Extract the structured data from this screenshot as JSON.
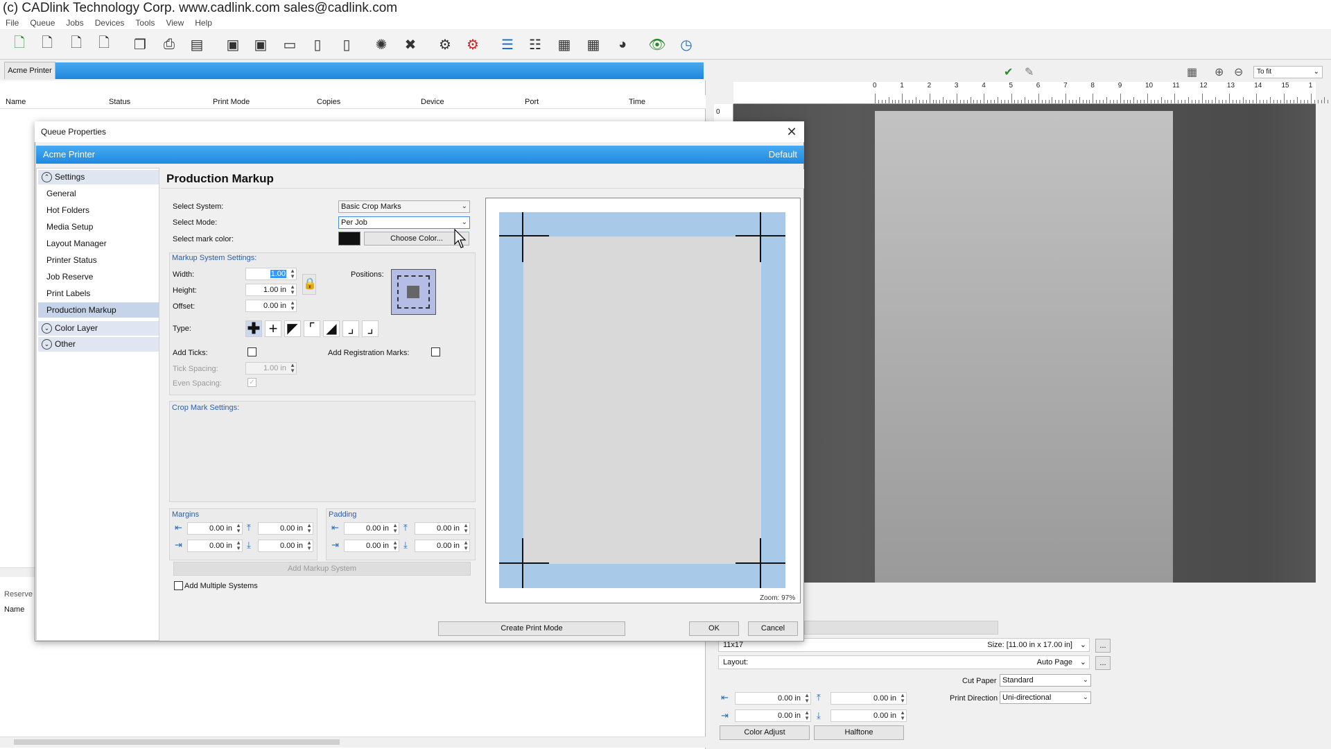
{
  "window": {
    "title": "(c) CADlink Technology Corp.  www.cadlink.com  sales@cadlink.com"
  },
  "menu": [
    "File",
    "Queue",
    "Jobs",
    "Devices",
    "Tools",
    "View",
    "Help"
  ],
  "queue": {
    "tab_label": "Acme Printer",
    "columns": [
      "Name",
      "Status",
      "Print Mode",
      "Copies",
      "Device",
      "Port",
      "Time"
    ],
    "reserve_tab": "Reserve",
    "reserve_column": "Name"
  },
  "preview": {
    "zoom_value": "To fit",
    "ruler_labels": [
      "0",
      "1",
      "2",
      "3",
      "4",
      "5",
      "6",
      "7",
      "8",
      "9",
      "10",
      "11",
      "12",
      "13",
      "14",
      "15",
      "1"
    ],
    "vruler_label": "0"
  },
  "dialog": {
    "title": "Queue Properties",
    "header_left": "Acme Printer",
    "header_right": "Default",
    "nav": {
      "settings": "Settings",
      "items": [
        "General",
        "Hot Folders",
        "Media Setup",
        "Layout Manager",
        "Printer Status",
        "Job Reserve",
        "Print Labels",
        "Production Markup"
      ],
      "color_layer": "Color Layer",
      "other": "Other"
    },
    "content_title": "Production Markup",
    "select_system_label": "Select System:",
    "select_system_value": "Basic Crop Marks",
    "select_mode_label": "Select Mode:",
    "select_mode_value": "Per Job",
    "select_mark_color_label": "Select mark color:",
    "mark_color": "#111111",
    "choose_color": "Choose Color...",
    "markup_settings_title": "Markup System Settings:",
    "width_label": "Width:",
    "width_value": "1.00",
    "height_label": "Height:",
    "height_value": "1.00 in",
    "offset_label": "Offset:",
    "offset_value": "0.00 in",
    "positions_label": "Positions:",
    "type_label": "Type:",
    "add_ticks_label": "Add Ticks:",
    "add_reg_marks_label": "Add Registration Marks:",
    "tick_spacing_label": "Tick Spacing:",
    "tick_spacing_value": "1.00 in",
    "even_spacing_label": "Even Spacing:",
    "crop_mark_settings_title": "Crop Mark Settings:",
    "margins_title": "Margins",
    "padding_title": "Padding",
    "margin_values": [
      "0.00 in",
      "0.00 in",
      "0.00 in",
      "0.00 in"
    ],
    "padding_values": [
      "0.00 in",
      "0.00 in",
      "0.00 in",
      "0.00 in"
    ],
    "add_markup_system": "Add Markup System",
    "add_multiple_systems": "Add Multiple Systems",
    "zoom_readout": "Zoom: 97%",
    "create_print_mode": "Create Print Mode",
    "ok": "OK",
    "cancel": "Cancel"
  },
  "job_props": {
    "media_name": "11x17",
    "size_text": "Size: [11.00 in x 17.00 in]",
    "layout_label": "Layout:",
    "layout_value": "Auto Page",
    "cut_paper_label": "Cut Paper",
    "cut_paper_value": "Standard",
    "print_direction_label": "Print Direction",
    "print_direction_value": "Uni-directional",
    "offset_values": [
      "0.00 in",
      "0.00 in",
      "0.00 in",
      "0.00 in"
    ],
    "color_adjust": "Color Adjust",
    "halftone": "Halftone",
    "ellipsis": "..."
  }
}
